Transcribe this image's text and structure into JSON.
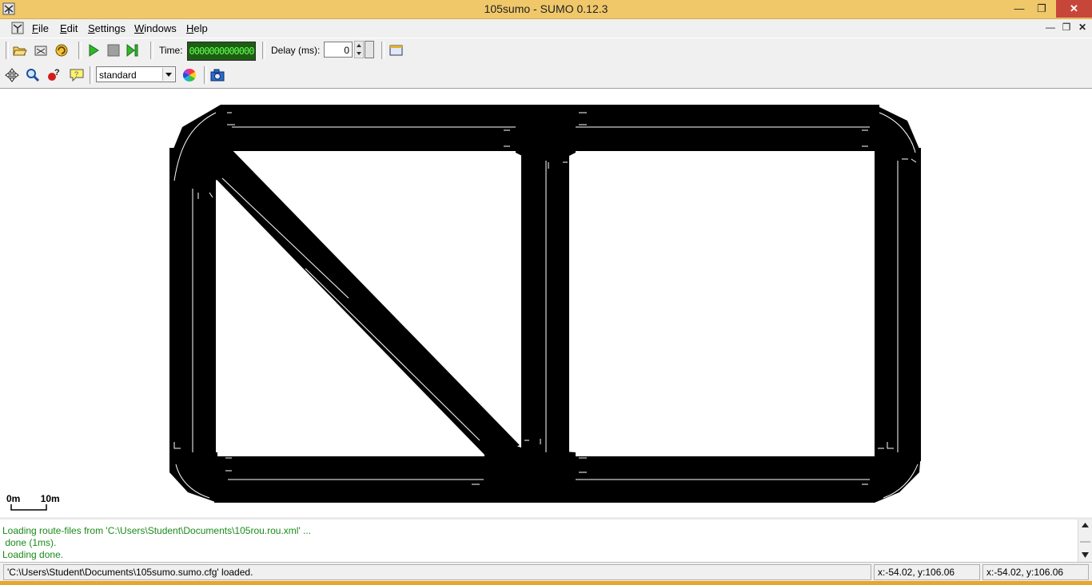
{
  "window": {
    "title": "105sumo - SUMO 0.12.3"
  },
  "menu": {
    "items": [
      {
        "label": "File",
        "mnemonic": "F",
        "rest": "ile"
      },
      {
        "label": "Edit",
        "mnemonic": "E",
        "rest": "dit"
      },
      {
        "label": "Settings",
        "mnemonic": "S",
        "rest": "ettings"
      },
      {
        "label": "Windows",
        "mnemonic": "W",
        "rest": "indows"
      },
      {
        "label": "Help",
        "mnemonic": "H",
        "rest": "elp"
      }
    ]
  },
  "toolbar": {
    "time_label": "Time:",
    "time_display": "0000000000000",
    "delay_label": "Delay (ms):",
    "delay_value": "0"
  },
  "view": {
    "scheme": "standard"
  },
  "scale": {
    "start": "0m",
    "end": "10m"
  },
  "log": {
    "lines": [
      "Loading route-files from 'C:\\Users\\Student\\Documents\\105rou.rou.xml' ...",
      " done (1ms).",
      "Loading done."
    ]
  },
  "status": {
    "message": "'C:\\Users\\Student\\Documents\\105sumo.sumo.cfg' loaded.",
    "coord1": "x:-54.02, y:106.06",
    "coord2": "x:-54.02, y:106.06"
  },
  "colors": {
    "titlebar": "#f0c86a",
    "close": "#c7463a",
    "log_text": "#1a8a1a",
    "lcd_bg": "#1e5e14",
    "lcd_fg": "#5dff4c",
    "road": "#000000"
  }
}
